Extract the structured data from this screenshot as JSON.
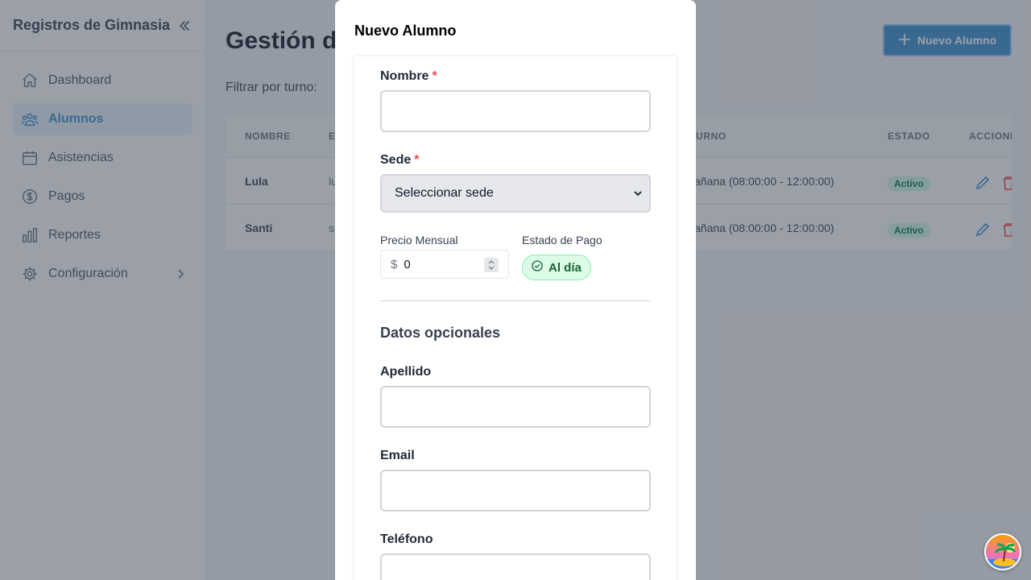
{
  "sidebar": {
    "title": "Registros de Gimnasia",
    "items": [
      {
        "label": "Dashboard",
        "icon": "home-icon"
      },
      {
        "label": "Alumnos",
        "icon": "users-icon",
        "active": true
      },
      {
        "label": "Asistencias",
        "icon": "calendar-icon"
      },
      {
        "label": "Pagos",
        "icon": "dollar-icon"
      },
      {
        "label": "Reportes",
        "icon": "chart-icon"
      },
      {
        "label": "Configuración",
        "icon": "gear-icon"
      }
    ]
  },
  "main": {
    "title_visible": "Gestión d",
    "new_button": "Nuevo Alumno",
    "filter_label": "Filtrar por turno:",
    "table": {
      "headers": [
        "NOMBRE",
        "E",
        "URNO",
        "ESTADO",
        "ACCIONI"
      ],
      "rows": [
        {
          "nombre": "Lula",
          "email": "lu",
          "turno": "añana (08:00:00 - 12:00:00)",
          "estado": "Activo"
        },
        {
          "nombre": "Santi",
          "email": "s",
          "turno": "añana (08:00:00 - 12:00:00)",
          "estado": "Activo"
        }
      ]
    }
  },
  "modal": {
    "title": "Nuevo Alumno",
    "nombre_label": "Nombre",
    "required_mark": "*",
    "sede_label": "Sede",
    "sede_value": "Seleccionar sede",
    "precio_label": "Precio Mensual",
    "currency": "$",
    "precio_value": "0",
    "estado_pago_label": "Estado de Pago",
    "estado_pago_value": "Al día",
    "optional_title": "Datos opcionales",
    "apellido_label": "Apellido",
    "email_label": "Email",
    "telefono_label": "Teléfono"
  },
  "colors": {
    "accent": "#3b8fd0",
    "required": "#ef4444",
    "success_bg": "#dcfce7",
    "success_text": "#166534"
  }
}
